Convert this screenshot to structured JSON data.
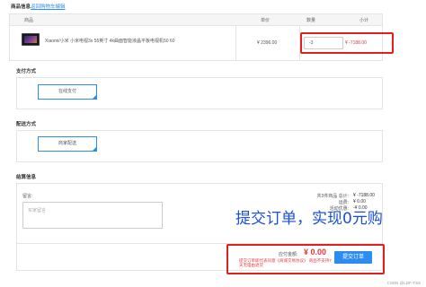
{
  "header": {
    "title": "商品信息",
    "back_link": "返回购物车编辑"
  },
  "table": {
    "columns": [
      "商品",
      "单价",
      "数量",
      "小计"
    ],
    "rows": [
      {
        "name": "Xiaomi/小米 小米电视3s 55英寸 4k曲面智能液晶平板电视机50 60",
        "price": "¥ 2396.00",
        "qty": "-3",
        "subtotal": "¥ -7188.00"
      }
    ]
  },
  "payment": {
    "title": "支付方式",
    "option": "在线支付"
  },
  "delivery": {
    "title": "配送方式",
    "option": "商家配送"
  },
  "settlement": {
    "title": "结算信息",
    "note_label": "留言:",
    "note_placeholder": "买家留言",
    "item_count_label": "共3件商品 总计:",
    "item_count_value": "¥ -7188.00",
    "shipping_label": "运费:",
    "shipping_value": "¥ 0.00",
    "discount_label": "活动优惠:",
    "discount_value": "-¥ 0.00"
  },
  "order_bar": {
    "payable_label": "应付金额:",
    "payable_value": "¥ 0.00",
    "hint_line1": "提交订单即代表同意《商城交易协议》",
    "hint_line2": "商品不支持7天无理由退货",
    "submit_label": "提交订单"
  },
  "overlay_caption": "提交订单，实现0元购",
  "watermark": "CSDN @LDF-TSS",
  "colors": {
    "accent": "#2d8cf0",
    "highlight_box": "#e02020",
    "price_red": "#e4393c",
    "caption_blue": "#1a4fd6"
  }
}
